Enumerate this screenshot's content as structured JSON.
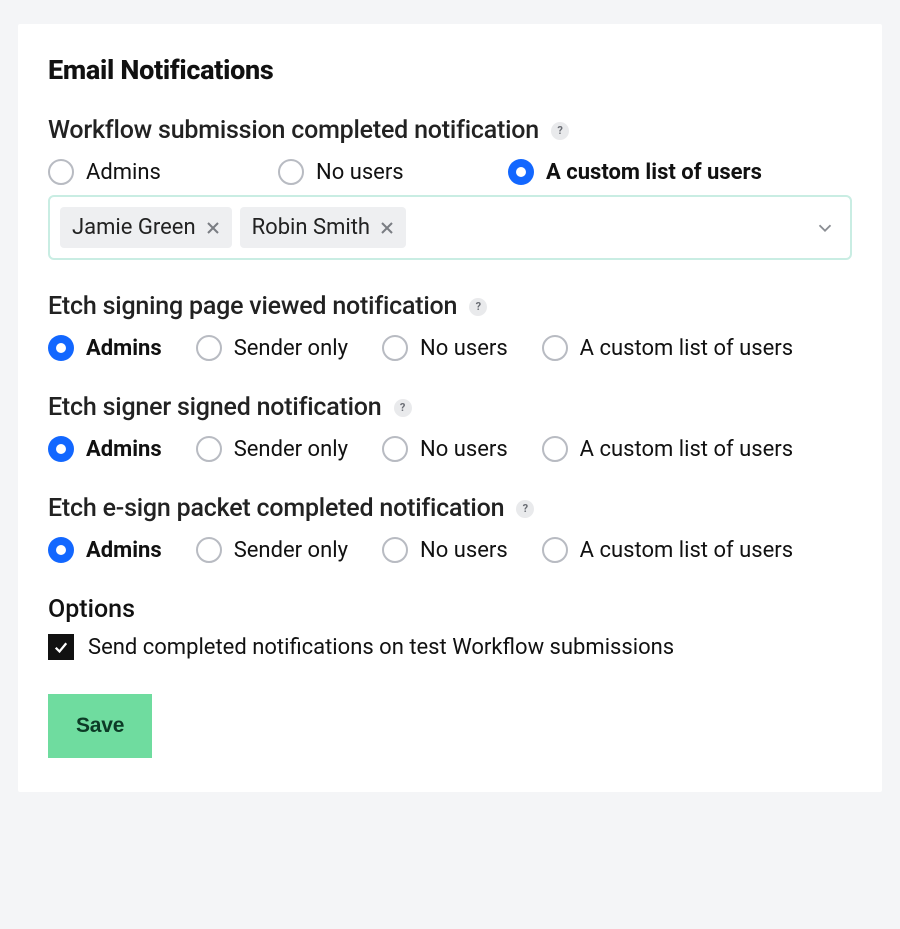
{
  "title": "Email Notifications",
  "sections": {
    "workflow_completed": {
      "heading": "Workflow submission completed notification",
      "options": [
        "Admins",
        "No users",
        "A custom list of users"
      ],
      "selected": 2,
      "users": [
        "Jamie Green",
        "Robin Smith"
      ]
    },
    "signing_viewed": {
      "heading": "Etch signing page viewed notification",
      "options": [
        "Admins",
        "Sender only",
        "No users",
        "A custom list of users"
      ],
      "selected": 0
    },
    "signer_signed": {
      "heading": "Etch signer signed notification",
      "options": [
        "Admins",
        "Sender only",
        "No users",
        "A custom list of users"
      ],
      "selected": 0
    },
    "packet_completed": {
      "heading": "Etch e-sign packet completed notification",
      "options": [
        "Admins",
        "Sender only",
        "No users",
        "A custom list of users"
      ],
      "selected": 0
    }
  },
  "options": {
    "heading": "Options",
    "send_test": {
      "label": "Send completed notifications on test Workflow submissions",
      "checked": true
    }
  },
  "save_label": "Save",
  "help_glyph": "?"
}
